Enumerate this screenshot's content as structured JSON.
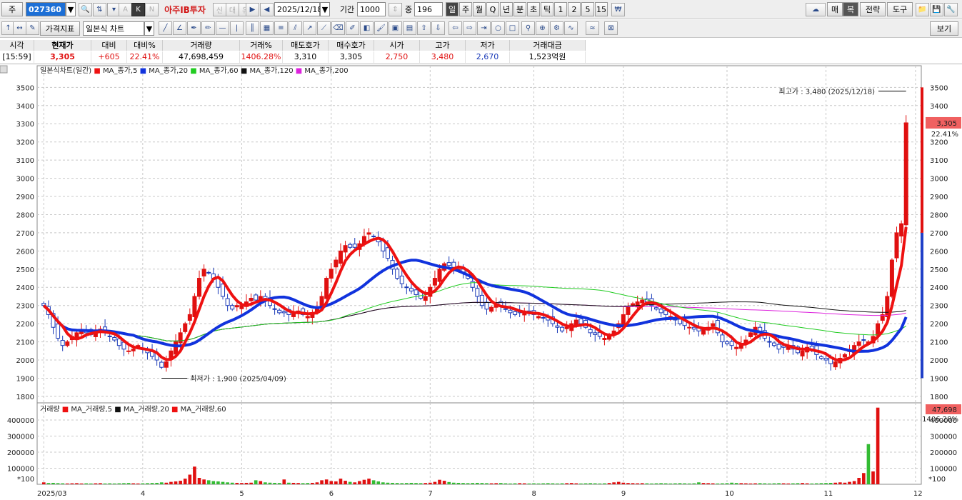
{
  "toolbar1": {
    "code_prefix": "주",
    "stock_code": "027360",
    "k_label": "K",
    "a_label": "A",
    "n_label": "N",
    "broker_name": "아주IB투자",
    "badge1": "신",
    "badge2": "대",
    "badge3": "유",
    "date": "2025/12/18",
    "period_label": "기간",
    "period_value": "1000",
    "count_label": "중",
    "count_value": "196",
    "periods": [
      "일",
      "주",
      "월",
      "Q",
      "년",
      "분",
      "초",
      "틱",
      "1",
      "2",
      "5",
      "15"
    ],
    "right_buttons": [
      "매",
      "복",
      "전략",
      "도구"
    ]
  },
  "toolbar2": {
    "price_indicator": "가격지표",
    "chart_type": "일본식 차트",
    "view_button": "보기"
  },
  "quote": {
    "headers": [
      "시각",
      "현재가",
      "대비",
      "대비%",
      "거래량",
      "거래%",
      "매도호가",
      "매수호가",
      "시가",
      "고가",
      "저가",
      "거래대금"
    ],
    "values": [
      "[15:59]",
      "3,305",
      "+605",
      "22.41%",
      "47,698,459",
      "1406.28%",
      "3,310",
      "3,305",
      "2,750",
      "3,480",
      "2,670",
      "1,523억원"
    ]
  },
  "legend": {
    "title": "일본식차트(일간)",
    "ma": [
      "MA_종가,5",
      "MA_종가,20",
      "MA_종가,60",
      "MA_종가,120",
      "MA_종가,200"
    ],
    "volume_title": "거래량",
    "vol_ma": [
      "MA_거래량,5",
      "MA_거래량,20",
      "MA_거래량,60"
    ]
  },
  "annotations": {
    "high": "최고가 : 3,480 (2025/12/18)",
    "low": "최저가 : 1,900 (2025/04/09)"
  },
  "right_labels": {
    "price": "3,305",
    "change_pct": "22.41%",
    "volume": "47,698",
    "volume_pct": "1406.28%",
    "unit": "*100"
  },
  "colors": {
    "up": "#e01010",
    "down": "#1a3ab8",
    "ma5": "#ee1111",
    "ma20": "#1133dd",
    "ma60": "#22cc22",
    "ma120": "#111111",
    "ma200": "#dd22dd"
  },
  "chart_data": {
    "type": "candlestick",
    "y_ticks": [
      1800,
      1900,
      2000,
      2100,
      2200,
      2300,
      2400,
      2500,
      2600,
      2700,
      2800,
      2900,
      3000,
      3100,
      3200,
      3300,
      3400,
      3500
    ],
    "ylim": [
      1780,
      3580
    ],
    "vol_ticks": [
      100000,
      200000,
      300000,
      400000
    ],
    "vol_ylim": [
      0,
      480000
    ],
    "x_labels": [
      "2025/03",
      "4",
      "5",
      "6",
      "7",
      "8",
      "9",
      "10",
      "11",
      "12"
    ],
    "x_label_index": [
      0,
      21,
      42,
      61,
      82,
      104,
      123,
      145,
      166,
      185
    ],
    "closes": [
      2300,
      2250,
      2180,
      2120,
      2080,
      2100,
      2130,
      2150,
      2160,
      2150,
      2140,
      2160,
      2170,
      2150,
      2130,
      2110,
      2080,
      2060,
      2050,
      2060,
      2080,
      2060,
      2040,
      2020,
      2000,
      1960,
      1990,
      2050,
      2100,
      2150,
      2200,
      2250,
      2350,
      2450,
      2500,
      2480,
      2450,
      2400,
      2350,
      2300,
      2280,
      2300,
      2300,
      2320,
      2340,
      2330,
      2350,
      2330,
      2300,
      2280,
      2260,
      2260,
      2250,
      2260,
      2270,
      2250,
      2240,
      2260,
      2280,
      2350,
      2450,
      2500,
      2550,
      2600,
      2630,
      2620,
      2620,
      2640,
      2680,
      2700,
      2680,
      2650,
      2600,
      2560,
      2500,
      2450,
      2420,
      2400,
      2380,
      2360,
      2340,
      2350,
      2400,
      2450,
      2500,
      2530,
      2520,
      2510,
      2500,
      2480,
      2450,
      2400,
      2350,
      2300,
      2280,
      2290,
      2310,
      2300,
      2280,
      2260,
      2250,
      2260,
      2270,
      2260,
      2250,
      2240,
      2230,
      2220,
      2200,
      2180,
      2160,
      2180,
      2200,
      2220,
      2200,
      2180,
      2150,
      2140,
      2130,
      2120,
      2140,
      2160,
      2200,
      2250,
      2290,
      2310,
      2320,
      2330,
      2320,
      2300,
      2280,
      2260,
      2250,
      2240,
      2220,
      2200,
      2190,
      2180,
      2170,
      2160,
      2170,
      2180,
      2200,
      2150,
      2100,
      2090,
      2080,
      2070,
      2090,
      2110,
      2150,
      2180,
      2150,
      2120,
      2100,
      2080,
      2060,
      2070,
      2080,
      2060,
      2040,
      2050,
      2070,
      2060,
      2030,
      2010,
      2000,
      1980,
      1990,
      2010,
      2030,
      2050,
      2080,
      2100,
      2110,
      2100,
      2130,
      2200,
      2250,
      2350,
      2550,
      2700,
      2750,
      3305
    ],
    "opens_offset_note": "",
    "volumes": [
      12000,
      8000,
      9000,
      7000,
      6000,
      5000,
      6000,
      7000,
      5000,
      6000,
      5000,
      6000,
      7000,
      5000,
      6000,
      5000,
      6000,
      7000,
      8000,
      6000,
      5000,
      6000,
      7000,
      8000,
      9000,
      12000,
      10000,
      15000,
      18000,
      22000,
      35000,
      60000,
      110000,
      40000,
      30000,
      25000,
      20000,
      18000,
      15000,
      12000,
      10000,
      9000,
      8000,
      9000,
      10000,
      25000,
      20000,
      12000,
      10000,
      9000,
      8000,
      30000,
      10000,
      9000,
      8000,
      7000,
      8000,
      9000,
      12000,
      25000,
      30000,
      20000,
      18000,
      35000,
      22000,
      15000,
      12000,
      20000,
      28000,
      35000,
      25000,
      18000,
      12000,
      10000,
      9000,
      8000,
      7000,
      8000,
      9000,
      8000,
      7000,
      8000,
      10000,
      15000,
      28000,
      22000,
      14000,
      10000,
      9000,
      8000,
      7000,
      8000,
      9000,
      8000,
      7000,
      6000,
      7000,
      8000,
      6000,
      5000,
      6000,
      7000,
      6000,
      5000,
      6000,
      5000,
      6000,
      7000,
      6000,
      5000,
      6000,
      7000,
      8000,
      6000,
      5000,
      6000,
      7000,
      6000,
      5000,
      6000,
      8000,
      12000,
      15000,
      10000,
      8000,
      7000,
      6000,
      7000,
      6000,
      5000,
      6000,
      7000,
      6000,
      5000,
      6000,
      7000,
      6000,
      5000,
      6000,
      12000,
      8000,
      7000,
      6000,
      5000,
      6000,
      7000,
      10000,
      8000,
      7000,
      6000,
      5000,
      6000,
      7000,
      6000,
      5000,
      6000,
      7000,
      6000,
      5000,
      6000,
      7000,
      8000,
      6000,
      5000,
      6000,
      7000,
      8000,
      9000,
      10000,
      12000,
      10000,
      15000,
      20000,
      40000,
      70000,
      250000,
      80000,
      476984
    ]
  }
}
